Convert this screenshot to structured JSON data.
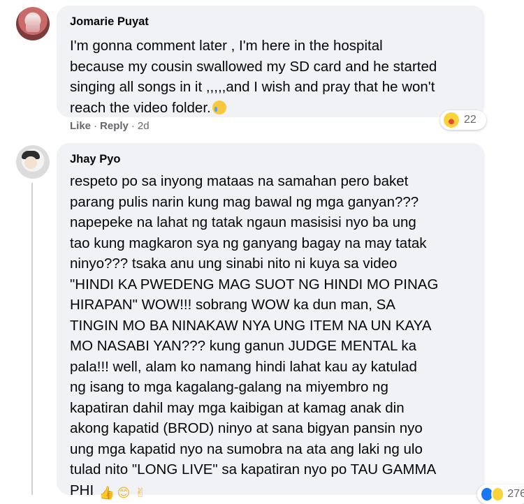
{
  "comments": [
    {
      "author": "Jomarie Puyat",
      "text": "I'm gonna comment later , I'm here in the hospital\nbecause my cousin swallowed my SD card and he started\nsinging all songs in it ,,,,,and I wish and pray that he won't\nreach the video folder.",
      "trailing_emoji": "crying-face",
      "reaction_icon": "haha-icon",
      "reaction_count": "22",
      "actions": {
        "like_label": "Like",
        "reply_label": "Reply",
        "time": "2d"
      }
    },
    {
      "author": "Jhay Pyo",
      "text": "respeto po sa inyong mataas na samahan pero baket\nparang pulis narin kung mag bawal ng mga ganyan???\nnapepeke na lahat ng tatak ngaun masisisi nyo ba ung\ntao kung magkaron sya ng ganyang bagay na may tatak\nninyo??? tsaka anu ung sinabi nito ni kuya sa video\n\"HINDI KA PWEDENG MAG SUOT NG HINDI MO PINAG\nHIRAPAN\" WOW!!! sobrang WOW ka dun man, SA\nTINGIN MO BA NINAKAW NYA UNG ITEM NA UN KAYA\nMO NASABI YAN??? kung ganun JUDGE MENTAL ka\npala!!! well, alam ko namang hindi lahat kau ay katulad\nng isang to mga kagalang-galang na miyembro ng\nkapatiran dahil may mga kaibigan at kamag anak din\nakong kapatid (BROD) ninyo at sana bigyan pansin nyo\nung mga kapatid nyo na sumobra na ata ang laki ng ulo\ntulad nito \"LONG LIVE\" sa kapatiran nyo po TAU GAMMA\nPHI",
      "trailing_emojis": [
        "thumbs-up",
        "smiling-face",
        "victory-hand"
      ],
      "thumbs_glyph": "👍",
      "smile_glyph": "😊",
      "victory_glyph": "✌",
      "reaction_icons": [
        "like-icon",
        "haha-icon"
      ],
      "reaction_count": "276"
    }
  ],
  "colors": {
    "bubble_bg": "#f0f2f5",
    "secondary_text": "#65676b",
    "thread_line": "#ced0d4"
  }
}
